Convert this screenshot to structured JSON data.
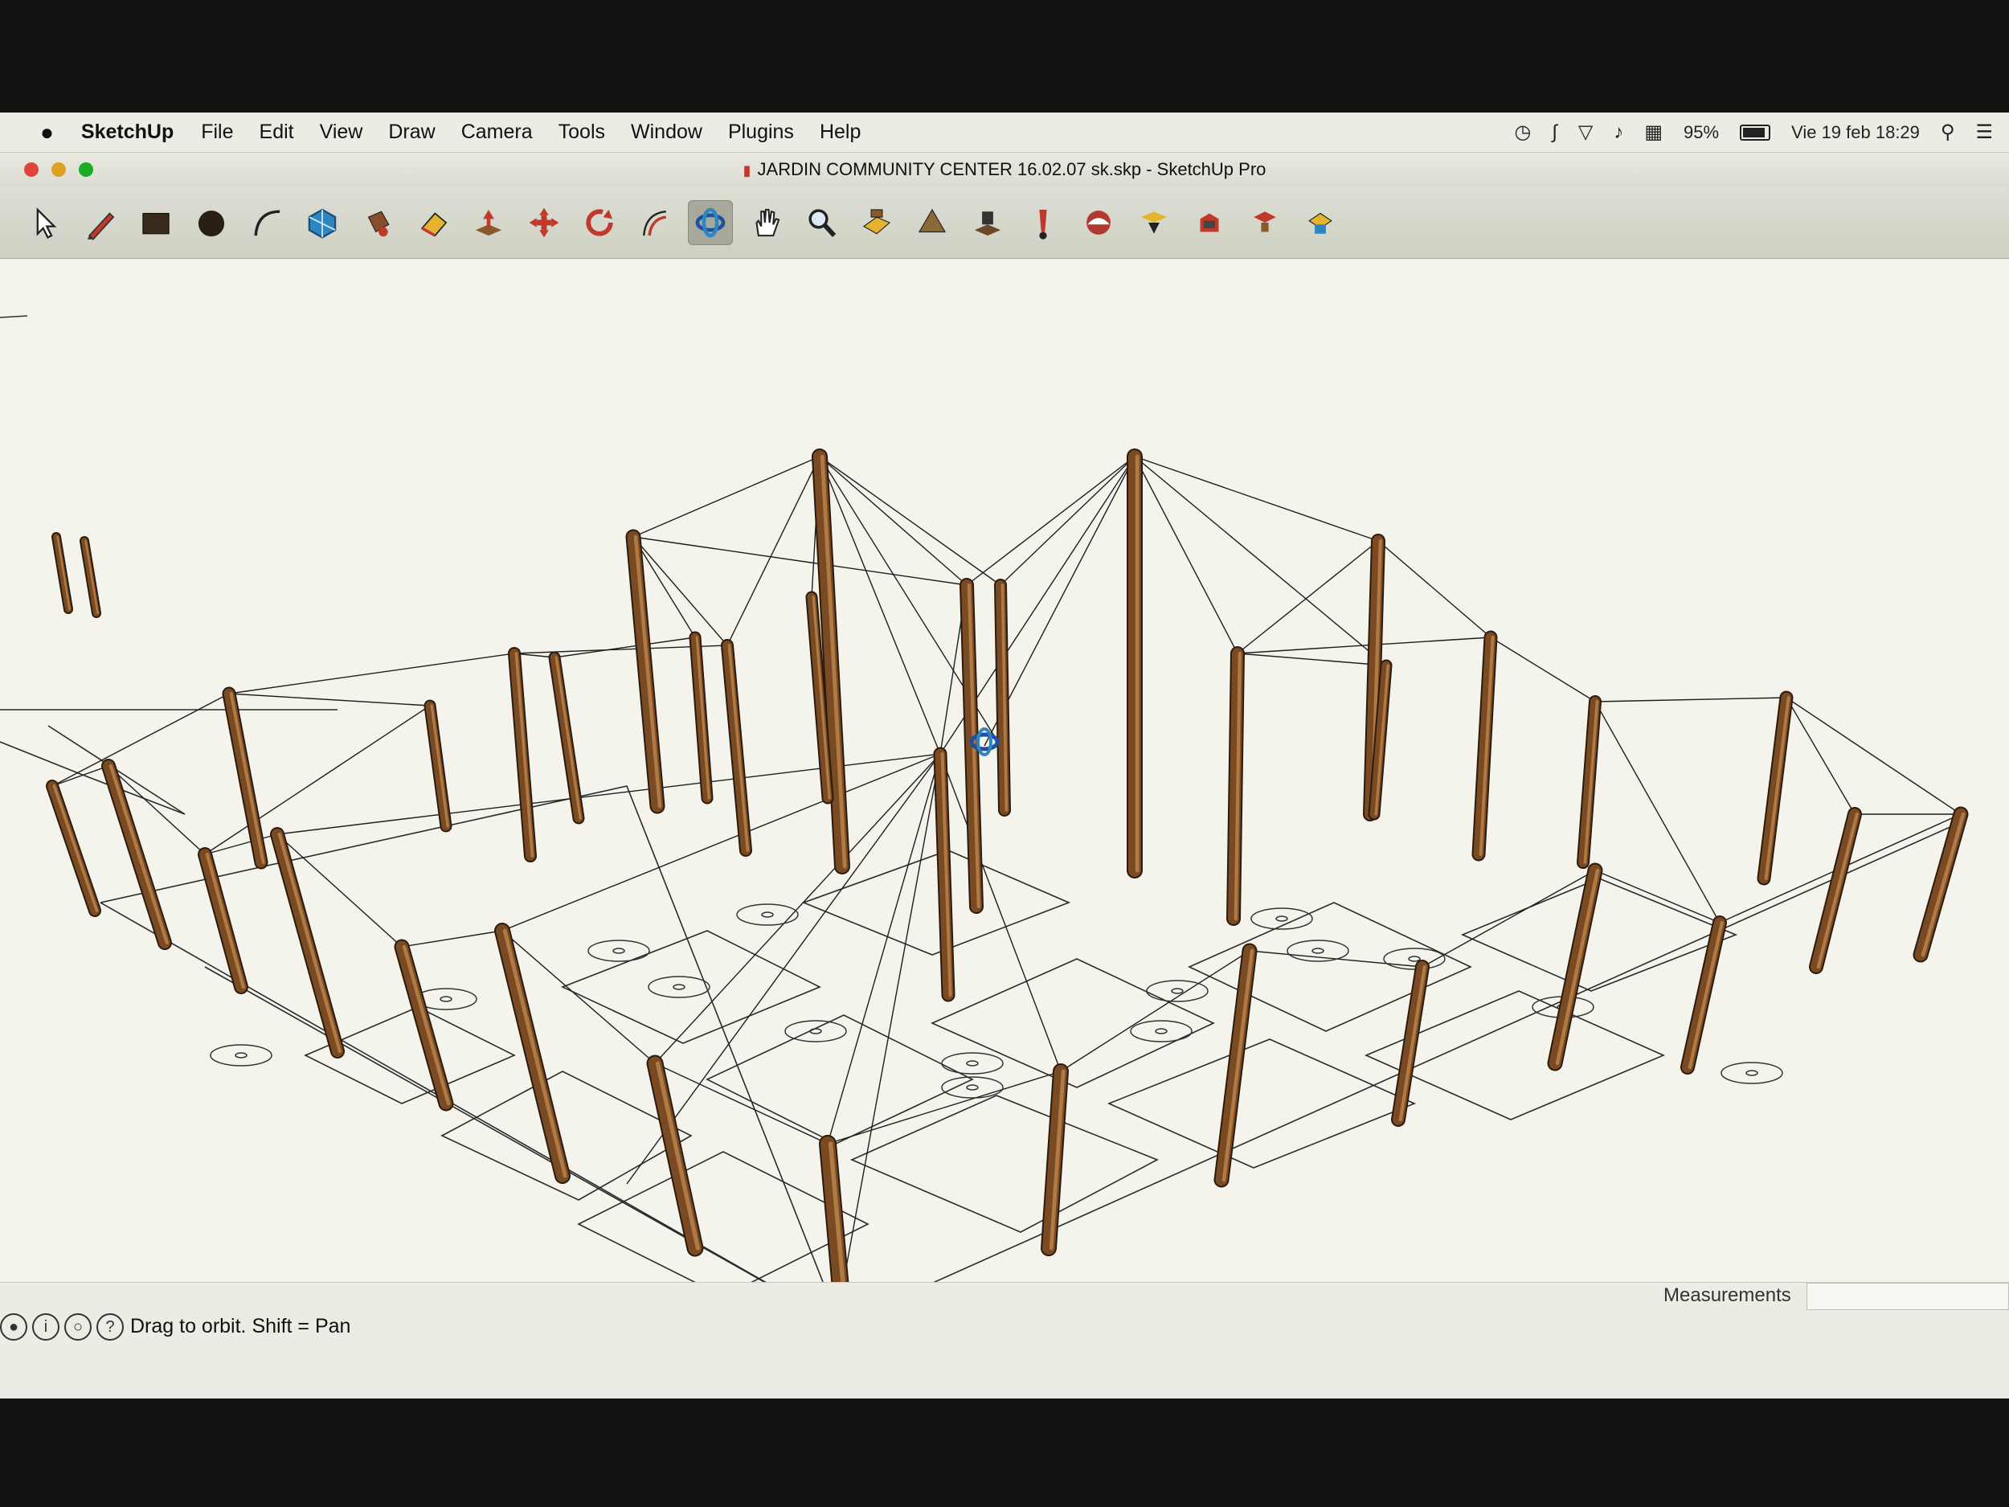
{
  "menubar": {
    "app_name": "SketchUp",
    "menus": [
      "File",
      "Edit",
      "View",
      "Draw",
      "Camera",
      "Tools",
      "Window",
      "Plugins",
      "Help"
    ],
    "status": {
      "battery": "95%",
      "datetime": "Vie 19 feb  18:29"
    },
    "icons": [
      "time-machine-icon",
      "bluetooth-icon",
      "wifi-icon",
      "volume-icon",
      "keyboard-input-icon",
      "battery-icon",
      "spotlight-icon",
      "notification-center-icon"
    ]
  },
  "window": {
    "title": "JARDIN COMMUNITY CENTER 16.02.07 sk.skp - SketchUp Pro",
    "traffic_lights": {
      "close": "#e0443e",
      "minimize": "#dea123",
      "zoom": "#1aab29"
    }
  },
  "toolbar": {
    "active_tool": "orbit",
    "tools": [
      "select",
      "pencil",
      "rectangle",
      "circle",
      "arc",
      "make-component",
      "paint-bucket",
      "eraser",
      "push-pull",
      "move",
      "rotate",
      "offset",
      "orbit",
      "pan",
      "zoom",
      "zoom-extents",
      "previous-view",
      "position-camera",
      "look-around",
      "walk",
      "section-plane",
      "add-location",
      "get-models",
      "share-model"
    ]
  },
  "statusbar": {
    "message": "Drag to orbit.  Shift = Pan",
    "measurements_label": "Measurements",
    "measurements_value": ""
  },
  "colors": {
    "post": "#7a4a22",
    "post_highlight": "#b07a45",
    "line": "#222222",
    "viewport_bg": "#f4f4ec"
  }
}
